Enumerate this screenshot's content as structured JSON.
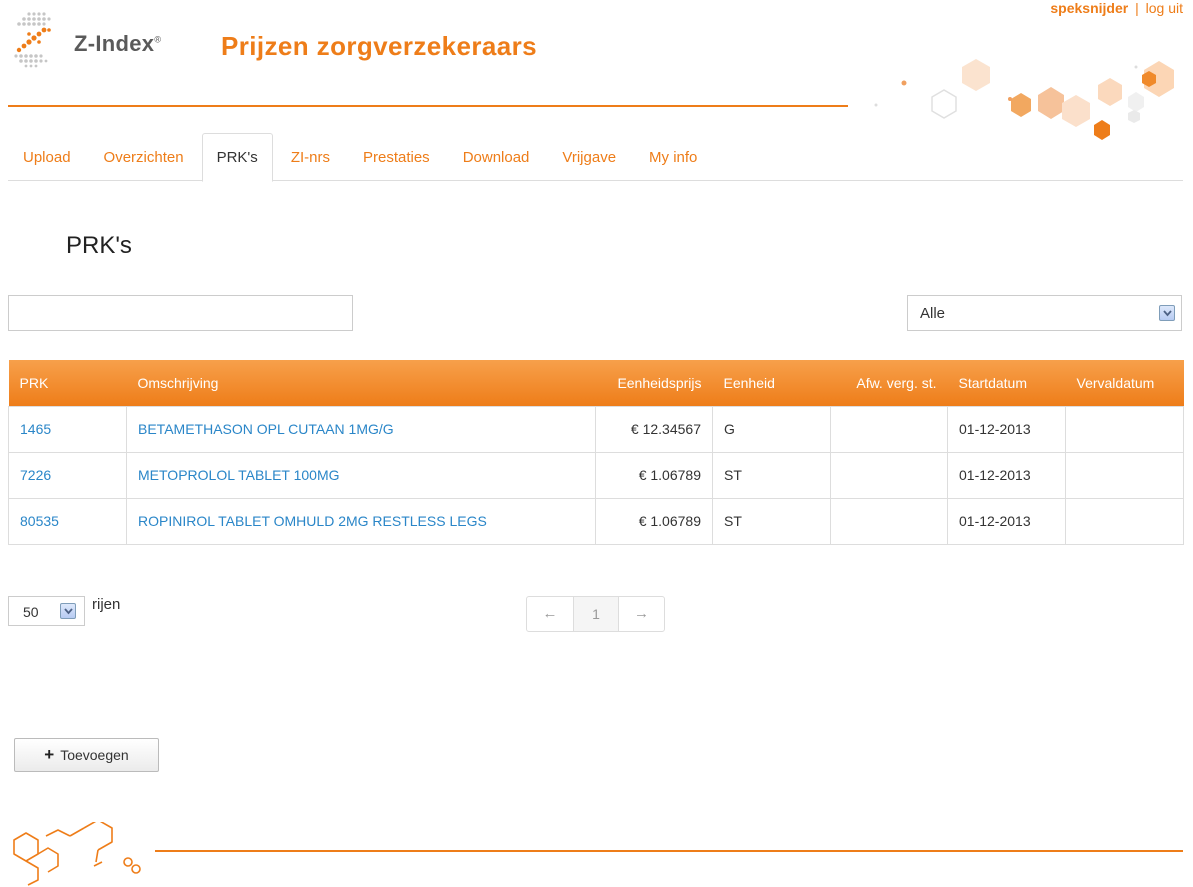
{
  "user": {
    "name": "speksnijder",
    "separator": "|",
    "logout": "log uit"
  },
  "brand": {
    "name": "Z-Index",
    "reg": "®",
    "title": "Prijzen zorgverzekeraars"
  },
  "colors": {
    "accent": "#ee7d19",
    "link": "#2a86c8"
  },
  "tabs": [
    {
      "label": "Upload",
      "active": false
    },
    {
      "label": "Overzichten",
      "active": false
    },
    {
      "label": "PRK's",
      "active": true
    },
    {
      "label": "ZI-nrs",
      "active": false
    },
    {
      "label": "Prestaties",
      "active": false
    },
    {
      "label": "Download",
      "active": false
    },
    {
      "label": "Vrijgave",
      "active": false
    },
    {
      "label": "My info",
      "active": false
    }
  ],
  "page": {
    "title": "PRK's"
  },
  "search": {
    "value": "",
    "placeholder": ""
  },
  "filter": {
    "selected": "Alle"
  },
  "table": {
    "headers": {
      "prk": "PRK",
      "omschrijving": "Omschrijving",
      "eenheidsprijs": "Eenheidsprijs",
      "eenheid": "Eenheid",
      "afw": "Afw. verg. st.",
      "startdatum": "Startdatum",
      "vervaldatum": "Vervaldatum"
    },
    "rows": [
      {
        "prk": "1465",
        "omschrijving": "BETAMETHASON OPL CUTAAN 1MG/G",
        "eenheidsprijs": "€ 12.34567",
        "eenheid": "G",
        "afw": "",
        "startdatum": "01-12-2013",
        "vervaldatum": ""
      },
      {
        "prk": "7226",
        "omschrijving": "METOPROLOL TABLET 100MG",
        "eenheidsprijs": "€ 1.06789",
        "eenheid": "ST",
        "afw": "",
        "startdatum": "01-12-2013",
        "vervaldatum": ""
      },
      {
        "prk": "80535",
        "omschrijving": "ROPINIROL TABLET OMHULD 2MG RESTLESS LEGS",
        "eenheidsprijs": "€ 1.06789",
        "eenheid": "ST",
        "afw": "",
        "startdatum": "01-12-2013",
        "vervaldatum": ""
      }
    ]
  },
  "pagination": {
    "page_size": "50",
    "rows_label": "rijen",
    "prev": "←",
    "current": "1",
    "next": "→"
  },
  "actions": {
    "add_icon": "+",
    "add_label": "Toevoegen"
  }
}
